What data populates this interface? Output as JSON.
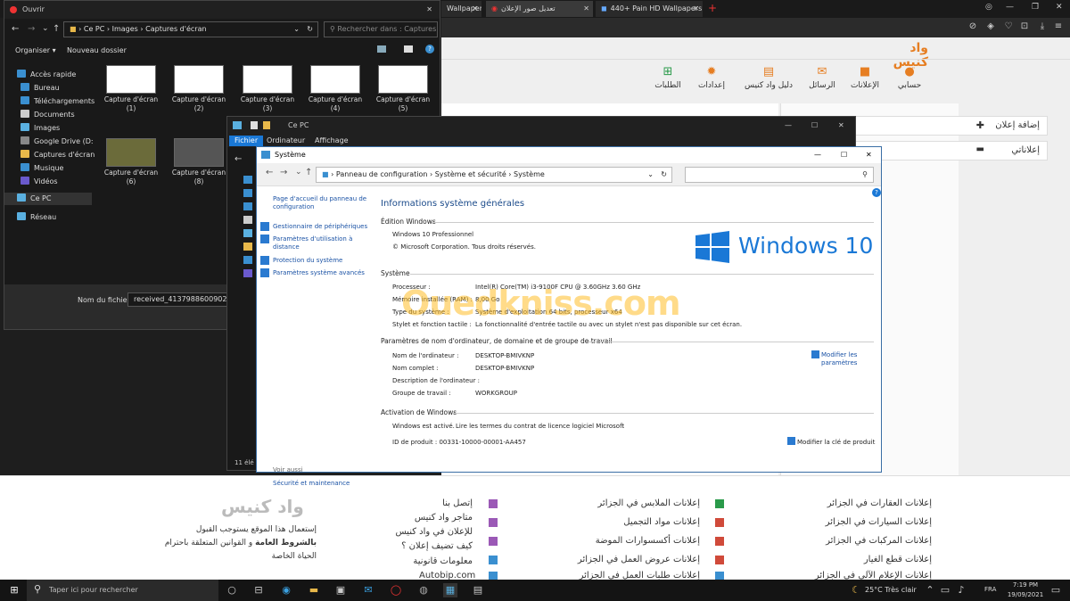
{
  "browser": {
    "tabs": [
      {
        "label": "Wallpaper"
      },
      {
        "label": "تعديل صور الإعلان"
      },
      {
        "label": "440+ Pain HD Wallpapers"
      }
    ],
    "new_tab": "+"
  },
  "site": {
    "logo": "واد كنيس",
    "nav": [
      "حسابي",
      "الإعلانات",
      "الرسائل",
      "دليل واد كنيس",
      "إعدادات",
      "الطلبات"
    ],
    "side_menu": [
      "إضافة إعلان",
      "إعلاناتي"
    ],
    "panel_headers": [
      "...",
      "..."
    ],
    "footer_col1": [
      "إعلانات العقارات في الجزائر",
      "إعلانات السيارات في الجزائر",
      "إعلانات المركبات في الجزائر",
      "إعلانات قطع الغيار",
      "إعلانات الإعلام الآلي في الجزائر"
    ],
    "footer_col2": [
      "إعلانات الملابس في الجزائر",
      "إعلانات مواد التجميل",
      "إعلانات أكسسوارات الموضة",
      "إعلانات عروض العمل في الجزائر",
      "إعلانات طلبات العمل في الجزائر"
    ],
    "footer_col3": [
      "إتصل بنا",
      "متاجر واد كنيس",
      "للإعلان في واد كنيس",
      "كيف تضيف إعلان ؟",
      "معلومات قانونية",
      "Autobip.com"
    ],
    "footer_text1": "إستعمال هذا الموقع يستوجب القبول",
    "footer_text2_a": "بالشروط العامة",
    "footer_text2_b": "و القوانين المتعلقة باحترام",
    "footer_text3": "الحياة الخاصة"
  },
  "explorer1": {
    "title": "Ouvrir",
    "address": [
      "Ce PC",
      "Images",
      "Captures d'écran"
    ],
    "search_placeholder": "Rechercher dans : Captures ...",
    "organize": "Organiser",
    "new_folder": "Nouveau dossier",
    "sidebar": [
      "Accès rapide",
      "Bureau",
      "Téléchargements",
      "Documents",
      "Images",
      "Google Drive (D:",
      "Captures d'écran",
      "Musique",
      "Vidéos",
      "Ce PC",
      "Réseau"
    ],
    "thumbs": [
      "Capture d'écran (1)",
      "Capture d'écran (2)",
      "Capture d'écran (3)",
      "Capture d'écran (4)",
      "Capture d'écran (5)",
      "Capture d'écran (6)",
      "Capture d'écran (8)"
    ],
    "filename_label": "Nom du fichier :",
    "filename_value": "received_413798860090242"
  },
  "explorer2": {
    "title": "Ce PC",
    "ribbon": [
      "Fichier",
      "Ordinateur",
      "Affichage"
    ],
    "status": "11 élé"
  },
  "system": {
    "title": "Système",
    "address": [
      "Panneau de configuration",
      "Système et sécurité",
      "Système"
    ],
    "left_links": [
      "Page d'accueil du panneau de configuration",
      "Gestionnaire de périphériques",
      "Paramètres d'utilisation à distance",
      "Protection du système",
      "Paramètres système avancés"
    ],
    "see_also": "Voir aussi",
    "see_also_link": "Sécurité et maintenance",
    "heading": "Informations système générales",
    "edition_header": "Édition Windows",
    "edition": "Windows 10 Professionnel",
    "copyright": "© Microsoft Corporation. Tous droits réservés.",
    "logo_text": "Windows 10",
    "system_header": "Système",
    "rows": [
      {
        "label": "Processeur :",
        "value": "Intel(R) Core(TM) i3-9100F CPU @ 3.60GHz   3.60 GHz"
      },
      {
        "label": "Mémoire installée (RAM) :",
        "value": "8,00 Go"
      },
      {
        "label": "Type du système :",
        "value": "Système d'exploitation 64 bits, processeur x64"
      },
      {
        "label": "Stylet et fonction tactile :",
        "value": "La fonctionnalité d'entrée tactile ou avec un stylet n'est pas disponible sur cet écran."
      }
    ],
    "computer_header": "Paramètres de nom d'ordinateur, de domaine et de groupe de travail",
    "computer_rows": [
      {
        "label": "Nom de l'ordinateur :",
        "value": "DESKTOP-BMIVKNP"
      },
      {
        "label": "Nom complet :",
        "value": "DESKTOP-BMIVKNP"
      },
      {
        "label": "Description de l'ordinateur :",
        "value": ""
      },
      {
        "label": "Groupe de travail :",
        "value": "WORKGROUP"
      }
    ],
    "change_settings": "Modifier les paramètres",
    "activation_header": "Activation de Windows",
    "activated": "Windows est activé.",
    "license_link": "Lire les termes du contrat de licence logiciel Microsoft",
    "product_id": "ID de produit : 00331-10000-00001-AA457",
    "change_key": "Modifier la clé de produit"
  },
  "watermark": "Ouedkniss.com",
  "taskbar": {
    "search_placeholder": "Taper ici pour rechercher",
    "weather": "25°C  Très clair",
    "lang": "FRA",
    "time": "7:19 PM",
    "date": "19/09/2021"
  },
  "colors": {
    "accent": "#e67e22",
    "windows_blue": "#1a78d6",
    "link": "#1a52a5"
  }
}
